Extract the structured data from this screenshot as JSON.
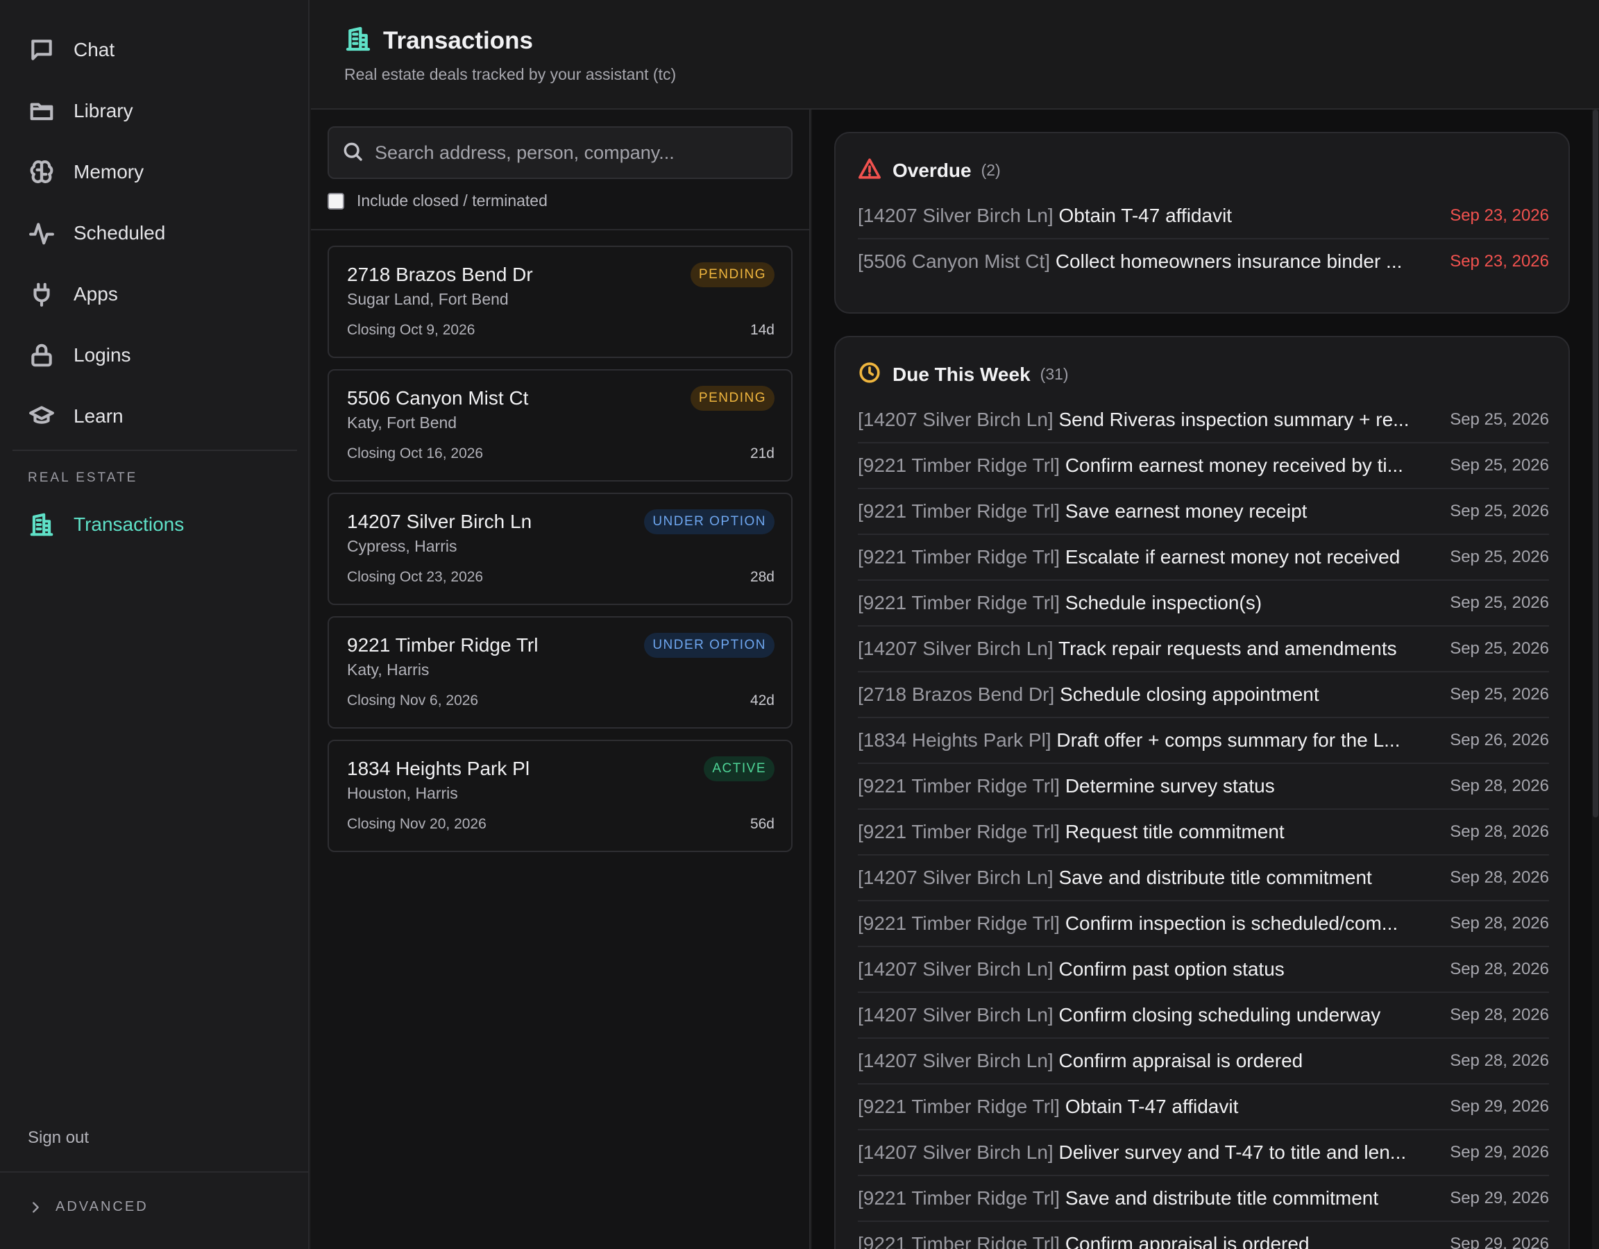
{
  "sidebar": {
    "nav": [
      {
        "label": "Chat",
        "icon": "chat-icon"
      },
      {
        "label": "Library",
        "icon": "folder-icon"
      },
      {
        "label": "Memory",
        "icon": "brain-icon"
      },
      {
        "label": "Scheduled",
        "icon": "activity-icon"
      },
      {
        "label": "Apps",
        "icon": "plug-icon"
      },
      {
        "label": "Logins",
        "icon": "lock-icon"
      },
      {
        "label": "Learn",
        "icon": "graduation-cap-icon"
      }
    ],
    "section_label": "REAL ESTATE",
    "section_item": {
      "label": "Transactions",
      "icon": "building-icon"
    },
    "sign_out": "Sign out",
    "advanced": "ADVANCED"
  },
  "header": {
    "title": "Transactions",
    "subtitle": "Real estate deals tracked by your assistant (tc)"
  },
  "list": {
    "search_placeholder": "Search address, person, company...",
    "include_closed_label": "Include closed / terminated",
    "include_closed_checked": false,
    "transactions": [
      {
        "address": "2718 Brazos Bend Dr",
        "location": "Sugar Land, Fort Bend",
        "closing": "Closing Oct 9, 2026",
        "days": "14d",
        "status": "PENDING",
        "status_kind": "pending"
      },
      {
        "address": "5506 Canyon Mist Ct",
        "location": "Katy, Fort Bend",
        "closing": "Closing Oct 16, 2026",
        "days": "21d",
        "status": "PENDING",
        "status_kind": "pending"
      },
      {
        "address": "14207 Silver Birch Ln",
        "location": "Cypress, Harris",
        "closing": "Closing Oct 23, 2026",
        "days": "28d",
        "status": "UNDER OPTION",
        "status_kind": "option"
      },
      {
        "address": "9221 Timber Ridge Trl",
        "location": "Katy, Harris",
        "closing": "Closing Nov 6, 2026",
        "days": "42d",
        "status": "UNDER OPTION",
        "status_kind": "option"
      },
      {
        "address": "1834 Heights Park Pl",
        "location": "Houston, Harris",
        "closing": "Closing Nov 20, 2026",
        "days": "56d",
        "status": "ACTIVE",
        "status_kind": "active"
      }
    ]
  },
  "overdue": {
    "title": "Overdue",
    "count": "(2)",
    "accent": "#f2524f",
    "tasks": [
      {
        "tag": "[14207 Silver Birch Ln]",
        "task": "Obtain T-47 affidavit",
        "date": "Sep 23, 2026"
      },
      {
        "tag": "[5506 Canyon Mist Ct]",
        "task": "Collect homeowners insurance binder ...",
        "date": "Sep 23, 2026"
      }
    ]
  },
  "due_week": {
    "title": "Due This Week",
    "count": "(31)",
    "accent": "#f0b63e",
    "tasks": [
      {
        "tag": "[14207 Silver Birch Ln]",
        "task": "Send Riveras inspection summary + re...",
        "date": "Sep 25, 2026"
      },
      {
        "tag": "[9221 Timber Ridge Trl]",
        "task": "Confirm earnest money received by ti...",
        "date": "Sep 25, 2026"
      },
      {
        "tag": "[9221 Timber Ridge Trl]",
        "task": "Save earnest money receipt",
        "date": "Sep 25, 2026"
      },
      {
        "tag": "[9221 Timber Ridge Trl]",
        "task": "Escalate if earnest money not received",
        "date": "Sep 25, 2026"
      },
      {
        "tag": "[9221 Timber Ridge Trl]",
        "task": "Schedule inspection(s)",
        "date": "Sep 25, 2026"
      },
      {
        "tag": "[14207 Silver Birch Ln]",
        "task": "Track repair requests and amendments",
        "date": "Sep 25, 2026"
      },
      {
        "tag": "[2718 Brazos Bend Dr]",
        "task": "Schedule closing appointment",
        "date": "Sep 25, 2026"
      },
      {
        "tag": "[1834 Heights Park Pl]",
        "task": "Draft offer + comps summary for the L...",
        "date": "Sep 26, 2026"
      },
      {
        "tag": "[9221 Timber Ridge Trl]",
        "task": "Determine survey status",
        "date": "Sep 28, 2026"
      },
      {
        "tag": "[9221 Timber Ridge Trl]",
        "task": "Request title commitment",
        "date": "Sep 28, 2026"
      },
      {
        "tag": "[14207 Silver Birch Ln]",
        "task": "Save and distribute title commitment",
        "date": "Sep 28, 2026"
      },
      {
        "tag": "[9221 Timber Ridge Trl]",
        "task": "Confirm inspection is scheduled/com...",
        "date": "Sep 28, 2026"
      },
      {
        "tag": "[14207 Silver Birch Ln]",
        "task": "Confirm past option status",
        "date": "Sep 28, 2026"
      },
      {
        "tag": "[14207 Silver Birch Ln]",
        "task": "Confirm closing scheduling underway",
        "date": "Sep 28, 2026"
      },
      {
        "tag": "[14207 Silver Birch Ln]",
        "task": "Confirm appraisal is ordered",
        "date": "Sep 28, 2026"
      },
      {
        "tag": "[9221 Timber Ridge Trl]",
        "task": "Obtain T-47 affidavit",
        "date": "Sep 29, 2026"
      },
      {
        "tag": "[14207 Silver Birch Ln]",
        "task": "Deliver survey and T-47 to title and len...",
        "date": "Sep 29, 2026"
      },
      {
        "tag": "[9221 Timber Ridge Trl]",
        "task": "Save and distribute title commitment",
        "date": "Sep 29, 2026"
      },
      {
        "tag": "[9221 Timber Ridge Trl]",
        "task": "Confirm appraisal is ordered",
        "date": "Sep 29, 2026"
      }
    ]
  }
}
